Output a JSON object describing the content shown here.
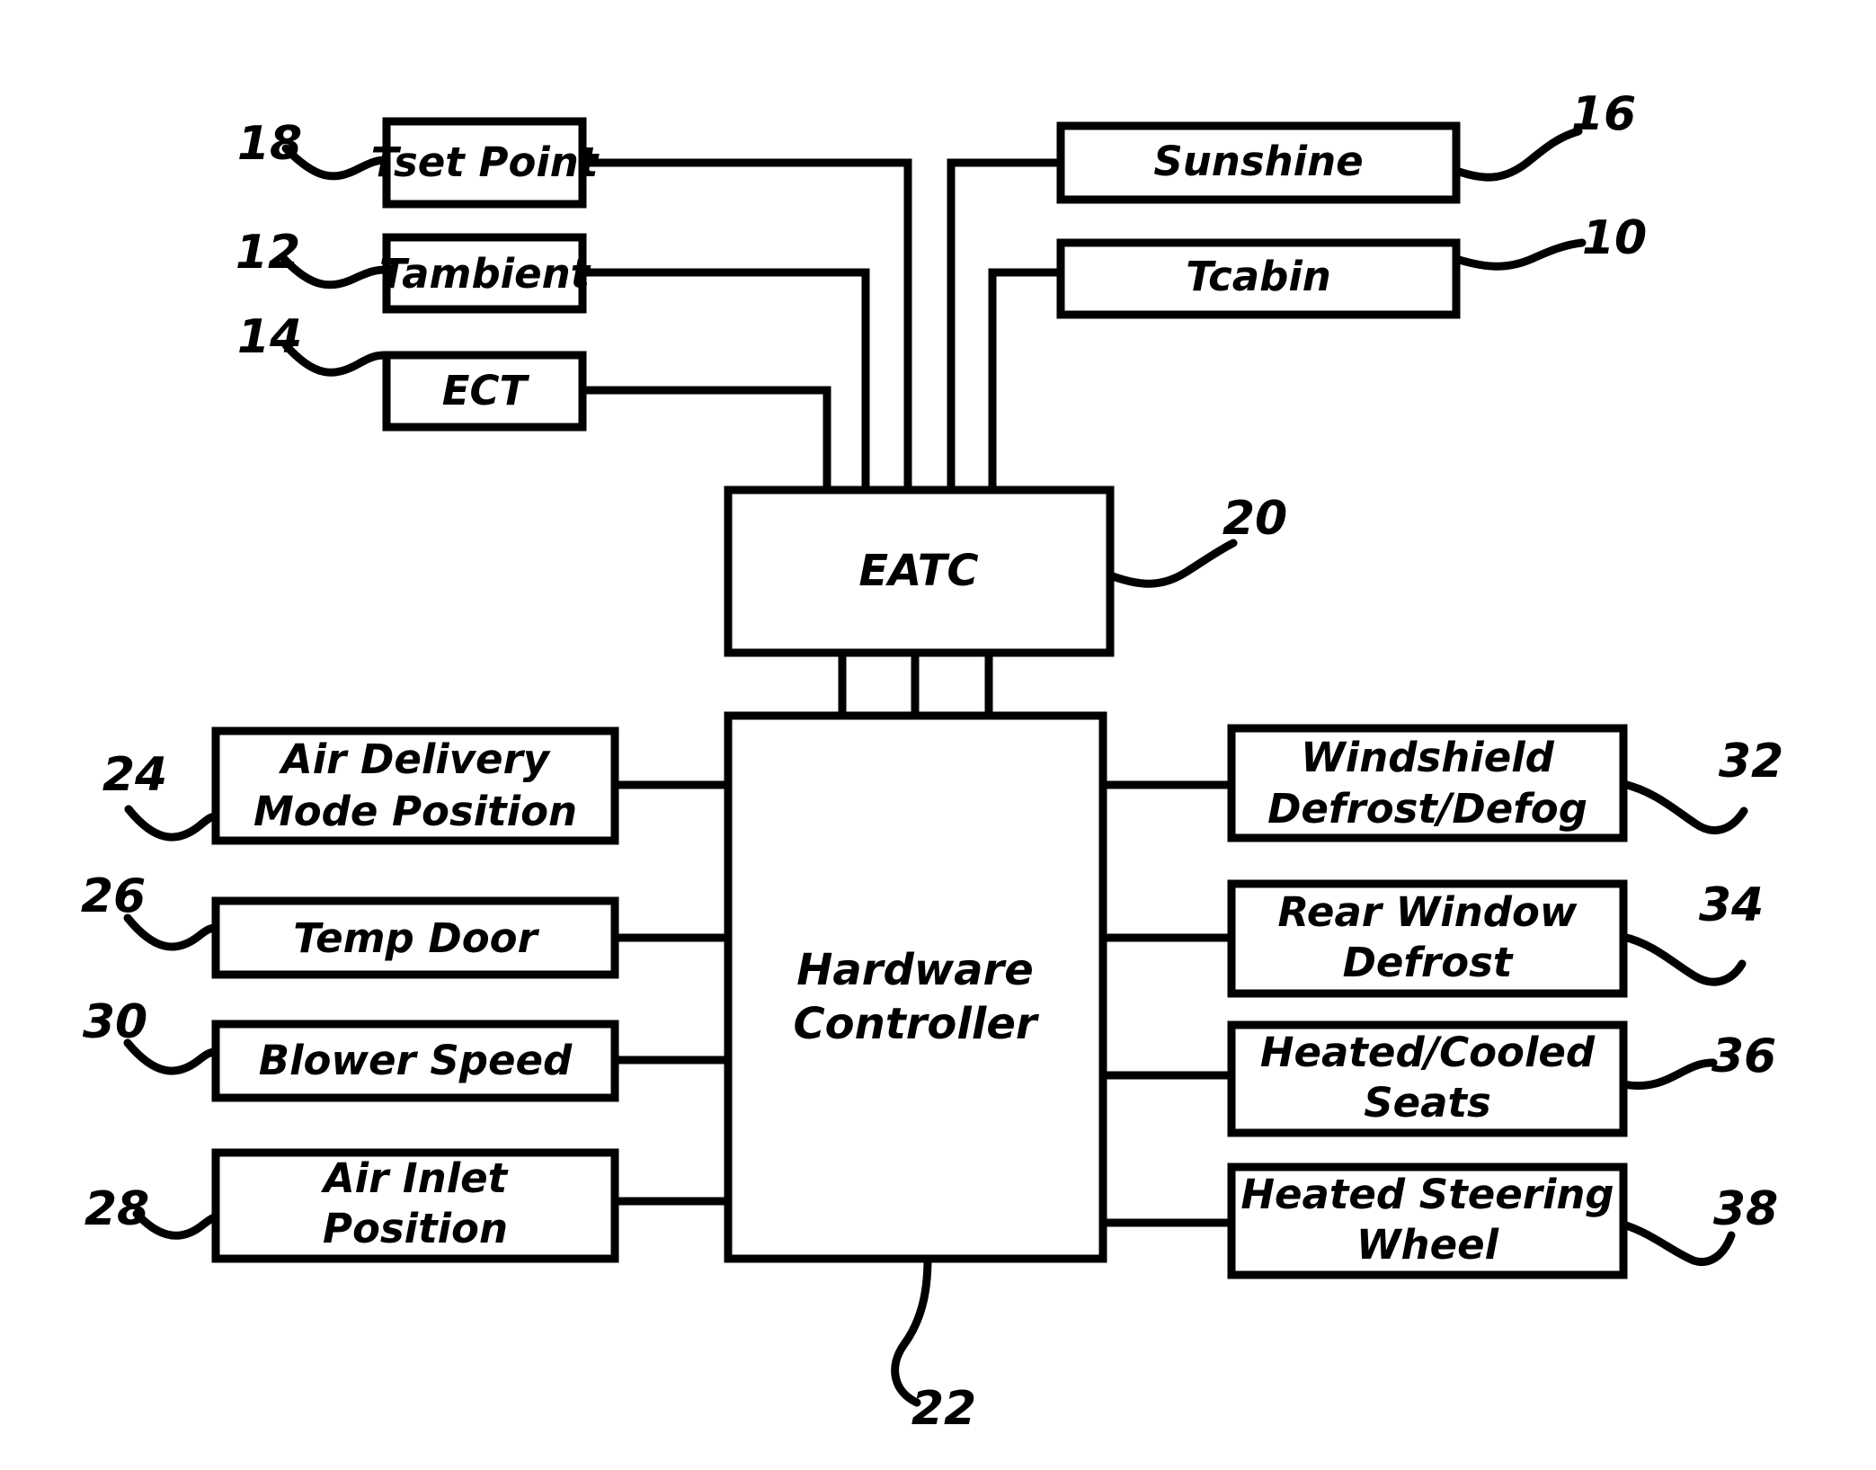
{
  "figure": {
    "type": "patent-block-diagram",
    "title": "Vehicle EATC climate control block diagram"
  },
  "inputs_left": [
    {
      "id": "tset",
      "label": "Tset Point",
      "ref": "18"
    },
    {
      "id": "tambient",
      "label": "Tambient",
      "ref": "12"
    },
    {
      "id": "ect",
      "label": "ECT",
      "ref": "14"
    }
  ],
  "inputs_right": [
    {
      "id": "sunshine",
      "label": "Sunshine",
      "ref": "16"
    },
    {
      "id": "tcabin",
      "label": "Tcabin",
      "ref": "10"
    }
  ],
  "controllers": [
    {
      "id": "eatc",
      "label": "EATC",
      "ref": "20"
    },
    {
      "id": "hardware",
      "line1": "Hardware",
      "line2": "Controller",
      "ref": "22"
    }
  ],
  "feedback_left": [
    {
      "id": "air-delivery-mode-position",
      "line1": "Air Delivery",
      "line2": "Mode Position",
      "ref": "24"
    },
    {
      "id": "temp-door",
      "line1": "Temp Door",
      "line2": "",
      "ref": "26"
    },
    {
      "id": "blower-speed",
      "line1": "Blower Speed",
      "line2": "",
      "ref": "30"
    },
    {
      "id": "air-inlet-position",
      "line1": "Air Inlet",
      "line2": "Position",
      "ref": "28"
    }
  ],
  "outputs_right": [
    {
      "id": "windshield-defrost-defog",
      "line1": "Windshield",
      "line2": "Defrost/Defog",
      "ref": "32"
    },
    {
      "id": "rear-window-defrost",
      "line1": "Rear Window",
      "line2": "Defrost",
      "ref": "34"
    },
    {
      "id": "heated-cooled-seats",
      "line1": "Heated/Cooled",
      "line2": "Seats",
      "ref": "36"
    },
    {
      "id": "heated-steering-wheel",
      "line1": "Heated Steering",
      "line2": "Wheel",
      "ref": "38"
    }
  ],
  "colors": {
    "stroke": "#000000",
    "fill": "#ffffff"
  }
}
